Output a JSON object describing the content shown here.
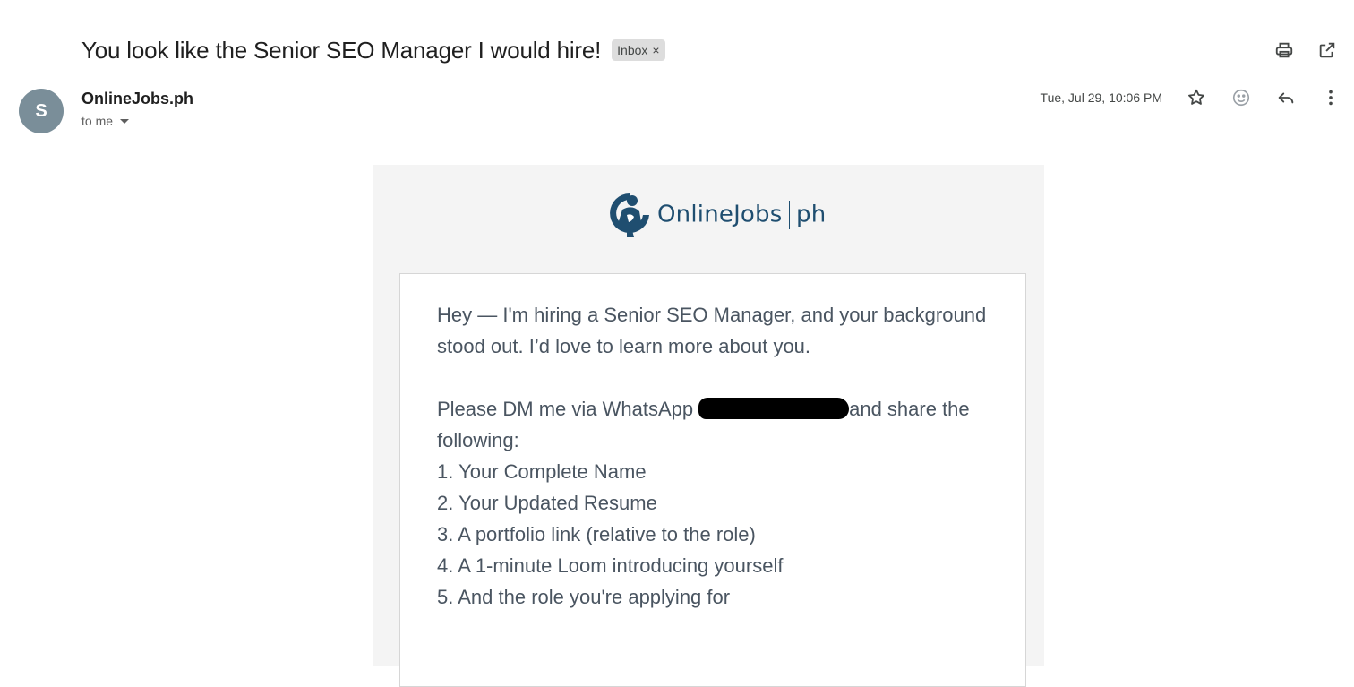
{
  "subject": "You look like the Senior SEO Manager I would hire!",
  "label": {
    "name": "Inbox",
    "remove_glyph": "×"
  },
  "toolbar": {
    "icons": [
      "print-icon",
      "open-in-new-window-icon"
    ]
  },
  "sender": {
    "avatar_letter": "S",
    "name": "OnlineJobs.ph",
    "recipient": "to me"
  },
  "meta": {
    "date": "Tue, Jul 29, 10:06 PM",
    "icons": [
      "star-icon",
      "emoji-icon",
      "reply-icon",
      "more-vert-icon"
    ]
  },
  "email": {
    "brand": {
      "name": "OnlineJobs",
      "suffix": "ph"
    },
    "para1": "Hey — I'm hiring a Senior SEO Manager, and your background stood out. I’d love to learn more about you.",
    "para2_before": "Please DM me via WhatsApp",
    "para2_after": "and share the following:",
    "list": [
      "1. Your Complete Name",
      "2. Your Updated Resume",
      "3. A portfolio link (relative to the role)",
      "4. A 1-minute Loom introducing yourself",
      "5. And the role you're applying for"
    ]
  },
  "colors": {
    "brand": "#1f4e70",
    "avatar": "#7a8e99",
    "body_bg": "#f4f4f4",
    "text": "#4a5561"
  }
}
